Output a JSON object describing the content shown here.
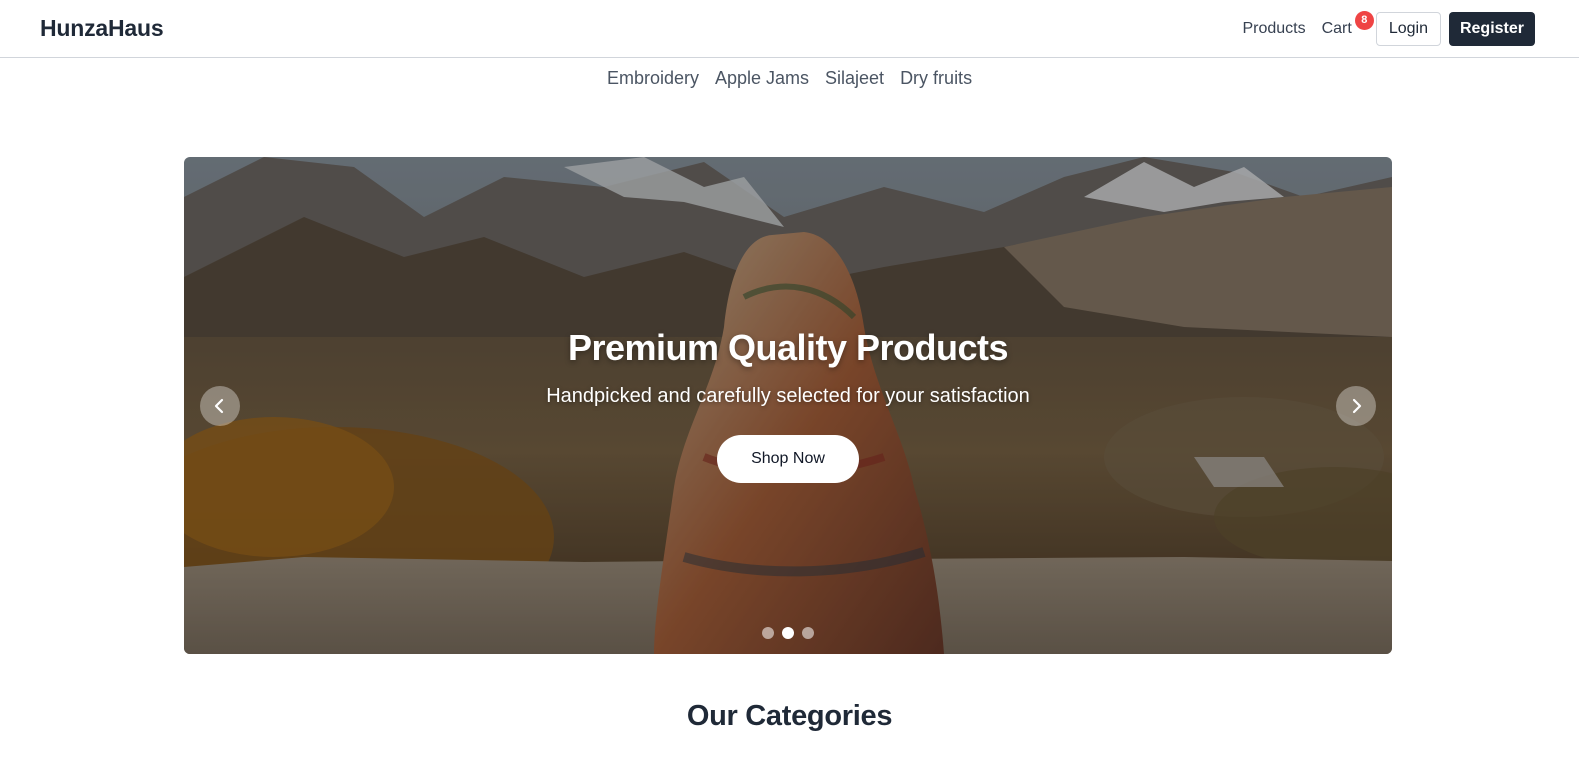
{
  "brand": "HunzaHaus",
  "nav": {
    "products": "Products",
    "cart": "Cart",
    "cart_count": "8",
    "login": "Login",
    "register": "Register"
  },
  "categories": [
    "Embroidery",
    "Apple Jams",
    "Silajeet",
    "Dry fruits"
  ],
  "hero": {
    "title": "Premium Quality Products",
    "subtitle": "Handpicked and carefully selected for your satisfaction",
    "cta": "Shop Now",
    "active_slide": 2,
    "slide_count": 3,
    "prev_icon": "chevron-left-icon",
    "next_icon": "chevron-right-icon"
  },
  "section": {
    "title": "Our Categories"
  },
  "colors": {
    "primary_dark": "#1f2937",
    "badge": "#ef4444",
    "text_muted": "#4b5563"
  }
}
